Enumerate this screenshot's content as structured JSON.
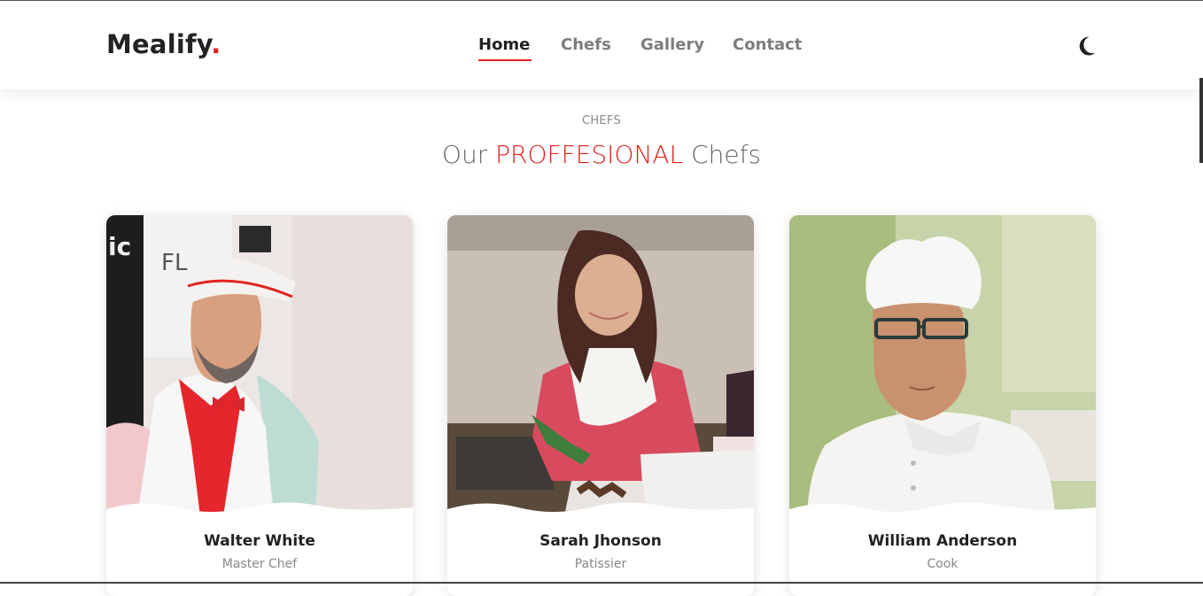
{
  "header": {
    "logo_text": "Mealify",
    "logo_dot": ".",
    "nav": [
      {
        "label": "Home",
        "active": true
      },
      {
        "label": "Chefs",
        "active": false
      },
      {
        "label": "Gallery",
        "active": false
      },
      {
        "label": "Contact",
        "active": false
      }
    ],
    "theme_icon": "moon-icon"
  },
  "section": {
    "kicker": "CHEFS",
    "title_pre": "Our ",
    "title_accent": "PROFFESIONAL",
    "title_post": " Chefs"
  },
  "chefs": [
    {
      "name": "Walter White",
      "role": "Master Chef"
    },
    {
      "name": "Sarah Jhonson",
      "role": "Patissier"
    },
    {
      "name": "William Anderson",
      "role": "Cook"
    }
  ],
  "colors": {
    "accent": "#e0231f",
    "text": "#222222",
    "muted": "#888888"
  }
}
